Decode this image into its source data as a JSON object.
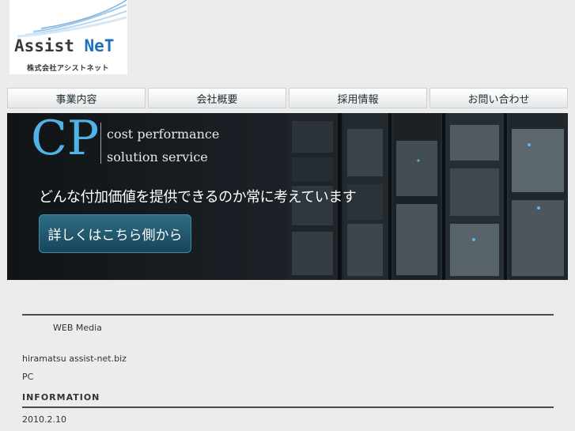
{
  "logo": {
    "brand_part1": "Assist ",
    "brand_part2": "NeT",
    "company_name": "株式会社アシストネット"
  },
  "nav": {
    "items": [
      {
        "label": "事業内容"
      },
      {
        "label": "会社概要"
      },
      {
        "label": "採用情報"
      },
      {
        "label": "お問い合わせ"
      }
    ]
  },
  "hero": {
    "cp_mark": "CP",
    "tagline_line1": "cost performance",
    "tagline_line2": "solution service",
    "headline": "どんな付加価値を提供できるのか常に考えています",
    "cta_label": "詳しくはこちら側から"
  },
  "content": {
    "media_label": "WEB Media",
    "email_text": "hiramatsu assist-net.biz",
    "pc_label": "PC",
    "information_heading": "INFORMATION",
    "date": "2010.2.10"
  },
  "colors": {
    "accent_blue": "#4fb3e6",
    "brand_blue": "#1f6fb8",
    "cta_teal": "#2f6e86",
    "page_bg": "#ececec"
  }
}
